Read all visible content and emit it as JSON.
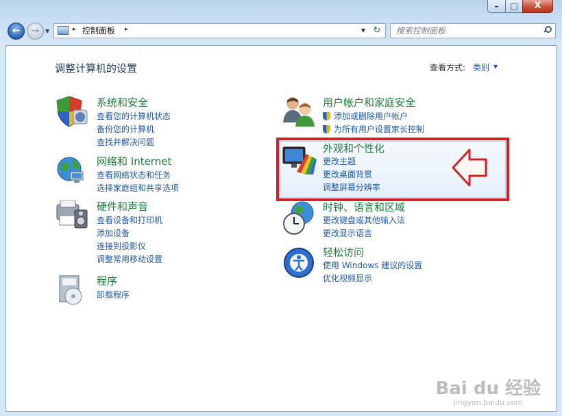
{
  "window": {
    "caption_buttons": {
      "minimize": "–",
      "maximize": "□",
      "close": "X"
    }
  },
  "nav": {
    "back_glyph": "←",
    "forward_glyph": "→",
    "address": {
      "breadcrumb": "控制面板",
      "separator": "▸"
    },
    "refresh_glyph": "↻",
    "search": {
      "placeholder": "搜索控制面板"
    }
  },
  "main": {
    "title": "调整计算机的设置",
    "view_by": {
      "label": "查看方式:",
      "value": "类别"
    }
  },
  "categories_left": [
    {
      "title": "系统和安全",
      "icon": "shield-icon",
      "links": [
        "查看您的计算机状态",
        "备份您的计算机",
        "查找并解决问题"
      ]
    },
    {
      "title": "网络和 Internet",
      "icon": "network-globe-icon",
      "links": [
        "查看网络状态和任务",
        "选择家庭组和共享选项"
      ]
    },
    {
      "title": "硬件和声音",
      "icon": "printer-speaker-icon",
      "links": [
        "查看设备和打印机",
        "添加设备",
        "连接到投影仪",
        "调整常用移动设置"
      ]
    },
    {
      "title": "程序",
      "icon": "programs-icon",
      "links": [
        "卸载程序"
      ]
    }
  ],
  "categories_right": [
    {
      "title": "用户帐户和家庭安全",
      "icon": "users-icon",
      "links": [
        "添加或删除用户帐户",
        "为所有用户设置家长控制"
      ]
    },
    {
      "title": "外观和个性化",
      "icon": "appearance-icon",
      "links": [
        "更改主题",
        "更改桌面背景",
        "调整屏幕分辨率"
      ]
    },
    {
      "title": "时钟、语言和区域",
      "icon": "clock-globe-icon",
      "links": [
        "更改键盘或其他输入法",
        "更改显示语言"
      ]
    },
    {
      "title": "轻松访问",
      "icon": "ease-of-access-icon",
      "links": [
        "使用 Windows 建议的设置",
        "优化视频显示"
      ]
    }
  ],
  "annotation": {
    "highlight_color": "#d2202a"
  },
  "watermark": {
    "main": "Bai du 经验",
    "sub": "jingyan.baidu.com"
  }
}
